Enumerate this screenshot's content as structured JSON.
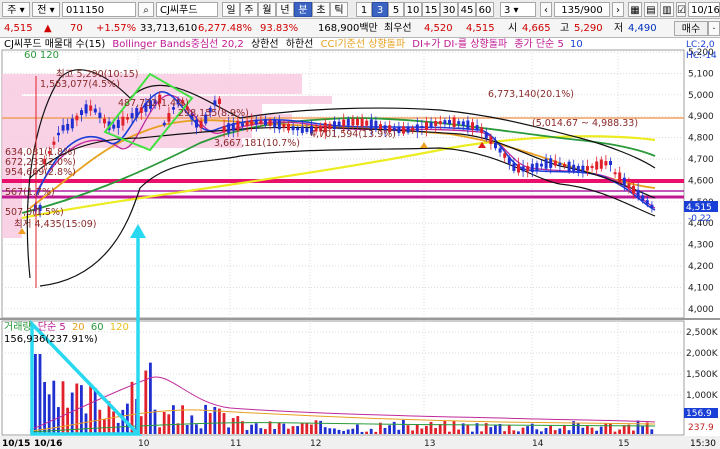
{
  "toolbar": {
    "mode": "주",
    "market": "전",
    "code": "011150",
    "search_icon": "search-icon",
    "name": "CJ씨푸드",
    "periods": [
      "일",
      "주",
      "월",
      "년",
      "분",
      "초",
      "틱"
    ],
    "active_period": "분",
    "intervals": [
      "1",
      "3",
      "5",
      "10",
      "15",
      "30",
      "45",
      "60"
    ],
    "active_interval": "3",
    "interval_select": "3",
    "count": "135/900",
    "date": "10/16"
  },
  "quote": {
    "price": "4,515",
    "change_symbol": "▲",
    "change": "70",
    "change_pct": "+1.57%",
    "volume": "33,713,610",
    "volume_pct": "6,277.48%",
    "strength": "93.83%",
    "amount": "168,900백만",
    "best_label": "최우선",
    "ask": "4,520",
    "bid": "4,515",
    "open_label": "시",
    "open": "4,665",
    "high_label": "고",
    "high": "5,290",
    "low_label": "저",
    "low": "4,490",
    "trade_button": "매수"
  },
  "legend": {
    "title": "CJ씨푸드 매물대 수(15)",
    "bollinger": "Bollinger Bands중심선 20,2",
    "upper": "상한선",
    "lower": "하한선",
    "cci": "CCI기준선 상향돌파",
    "dmi": "DI+가 DI-를 상향돌파",
    "ma": "종가 단순 5",
    "ma10": "10",
    "sub": "60 120",
    "lc": "LC:2,0",
    "hc": "HC:-14"
  },
  "annotations": {
    "high": "최고 5,290(10:15)",
    "cum": "1,563,077(4.5%)",
    "p1": "487,732(1.4%)",
    "p2": "298,155(8.9%)",
    "p3": "3,667,181(10.7%)",
    "p4": "4,701,594(13.9%)",
    "p5": "6,773,140(20.1%)",
    "p6": "634,081(1.8%)",
    "p7": "672,233(2.0%)",
    "p8": "954,669(2.8%)",
    "p9": "567(1.7%)",
    "p10": "507,0(1.5%)",
    "range": "(5,014.67 ~ 4,988.33)",
    "low": "최저 4,435(15:09)"
  },
  "price_axis": [
    "5,200",
    "5,100",
    "5,000",
    "4,900",
    "4,800",
    "4,700",
    "4,600",
    "4,500",
    "4,400",
    "4,300",
    "4,200",
    "4,100",
    "4,000"
  ],
  "price_tag": "4,515",
  "price_tag2": "-0.22",
  "volume_legend": {
    "label": "거래량",
    "ma": "단순 5",
    "n20": "20",
    "n60": "60",
    "n120": "120",
    "value": "156,936(237.91%)"
  },
  "volume_axis": [
    "2,500K",
    "2,000K",
    "1,500K",
    "1,000K"
  ],
  "volume_tag": "156.9",
  "volume_tag2": "237.9",
  "time_axis": {
    "start": "10/15",
    "start2": "10/16",
    "labels": [
      "10",
      "11",
      "12",
      "13",
      "14",
      "15"
    ],
    "clock": "15:30"
  },
  "colors": {
    "ma5": "#1a3fd6",
    "ma10": "#c0289a",
    "ma20": "#e8a020",
    "ma60": "#2a9a3a",
    "ma120": "#e8e020",
    "up": "#e0202a",
    "down": "#2030d0",
    "band": "#f5b8d8",
    "drawing_cyan": "#28d8f0",
    "drawing_green": "#40e040"
  }
}
